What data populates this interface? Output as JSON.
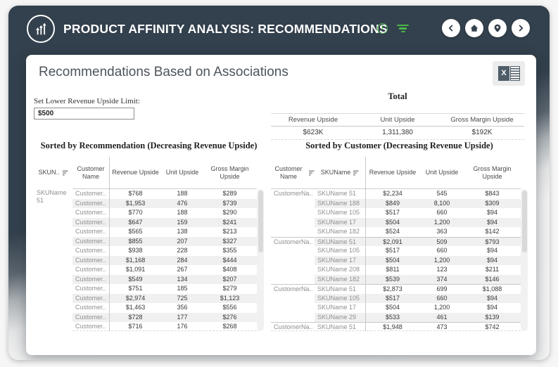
{
  "colors": {
    "navy": "#33404d",
    "green": "#4cb64c",
    "band_gray": "#f0f0f1",
    "card_bg": "#ffffff"
  },
  "topbar": {
    "title": "PRODUCT AFFINITY ANALYSIS: RECOMMENDATIONS"
  },
  "card": {
    "heading": "Recommendations Based on Associations",
    "parameter": {
      "label": "Set Lower Revenue Upside Limit:",
      "value": "$500"
    },
    "total": {
      "title": "Total",
      "columns": [
        "Revenue Upside",
        "Unit Upside",
        "Gross Margin Upside"
      ],
      "values": [
        "$623K",
        "1,311,380",
        "$192K"
      ]
    }
  },
  "left_table": {
    "title": "Sorted by Recommendation (Decreasing Revenue Upside)",
    "columns": [
      "SKUN..",
      "Customer Name",
      "Revenue Upside",
      "Unit Upside",
      "Gross Margin Upside"
    ],
    "row_header": "SKUName 51",
    "rows": [
      {
        "customer": "Customer..",
        "revenue": "$768",
        "units": "188",
        "margin": "$289"
      },
      {
        "customer": "Customer..",
        "revenue": "$1,953",
        "units": "476",
        "margin": "$739"
      },
      {
        "customer": "Customer..",
        "revenue": "$770",
        "units": "188",
        "margin": "$290"
      },
      {
        "customer": "Customer..",
        "revenue": "$647",
        "units": "159",
        "margin": "$241"
      },
      {
        "customer": "Customer..",
        "revenue": "$565",
        "units": "138",
        "margin": "$213"
      },
      {
        "customer": "Customer..",
        "revenue": "$855",
        "units": "207",
        "margin": "$327"
      },
      {
        "customer": "Customer..",
        "revenue": "$938",
        "units": "228",
        "margin": "$355"
      },
      {
        "customer": "Customer..",
        "revenue": "$1,168",
        "units": "284",
        "margin": "$444"
      },
      {
        "customer": "Customer..",
        "revenue": "$1,091",
        "units": "267",
        "margin": "$408"
      },
      {
        "customer": "Customer..",
        "revenue": "$549",
        "units": "134",
        "margin": "$207"
      },
      {
        "customer": "Customer..",
        "revenue": "$751",
        "units": "185",
        "margin": "$279"
      },
      {
        "customer": "Customer..",
        "revenue": "$2,974",
        "units": "725",
        "margin": "$1,123"
      },
      {
        "customer": "Customer..",
        "revenue": "$1,463",
        "units": "356",
        "margin": "$556"
      },
      {
        "customer": "Customer..",
        "revenue": "$728",
        "units": "177",
        "margin": "$276"
      },
      {
        "customer": "Customer..",
        "revenue": "$716",
        "units": "176",
        "margin": "$268"
      }
    ]
  },
  "right_table": {
    "title": "Sorted by Customer (Decreasing Revenue Upside)",
    "columns": [
      "Customer Name",
      "SKUName",
      "Revenue Upside",
      "Unit Upside",
      "Gross Margin Upside"
    ],
    "rows": [
      {
        "customer": "CustomerNa..",
        "sku": "SKUName 51",
        "revenue": "$2,234",
        "units": "545",
        "margin": "$843",
        "group_start": true
      },
      {
        "customer": "",
        "sku": "SKUName 188",
        "revenue": "$849",
        "units": "8,100",
        "margin": "$309",
        "group_start": false
      },
      {
        "customer": "",
        "sku": "SKUName 105",
        "revenue": "$517",
        "units": "660",
        "margin": "$94",
        "group_start": false
      },
      {
        "customer": "",
        "sku": "SKUName 17",
        "revenue": "$504",
        "units": "1,200",
        "margin": "$94",
        "group_start": false
      },
      {
        "customer": "",
        "sku": "SKUName 182",
        "revenue": "$524",
        "units": "363",
        "margin": "$142",
        "group_start": false
      },
      {
        "customer": "CustomerNa..",
        "sku": "SKUName 51",
        "revenue": "$2,091",
        "units": "509",
        "margin": "$793",
        "group_start": true
      },
      {
        "customer": "",
        "sku": "SKUName 105",
        "revenue": "$517",
        "units": "660",
        "margin": "$94",
        "group_start": false
      },
      {
        "customer": "",
        "sku": "SKUName 17",
        "revenue": "$504",
        "units": "1,200",
        "margin": "$94",
        "group_start": false
      },
      {
        "customer": "",
        "sku": "SKUName 208",
        "revenue": "$811",
        "units": "123",
        "margin": "$211",
        "group_start": false
      },
      {
        "customer": "",
        "sku": "SKUName 182",
        "revenue": "$539",
        "units": "374",
        "margin": "$146",
        "group_start": false
      },
      {
        "customer": "CustomerNa..",
        "sku": "SKUName 51",
        "revenue": "$2,873",
        "units": "699",
        "margin": "$1,088",
        "group_start": true
      },
      {
        "customer": "",
        "sku": "SKUName 105",
        "revenue": "$517",
        "units": "660",
        "margin": "$94",
        "group_start": false
      },
      {
        "customer": "",
        "sku": "SKUName 17",
        "revenue": "$504",
        "units": "1,200",
        "margin": "$94",
        "group_start": false
      },
      {
        "customer": "",
        "sku": "SKUName 29",
        "revenue": "$533",
        "units": "461",
        "margin": "$139",
        "group_start": false
      },
      {
        "customer": "CustomerNa..",
        "sku": "SKUName 51",
        "revenue": "$1,948",
        "units": "473",
        "margin": "$742",
        "group_start": true
      }
    ]
  }
}
